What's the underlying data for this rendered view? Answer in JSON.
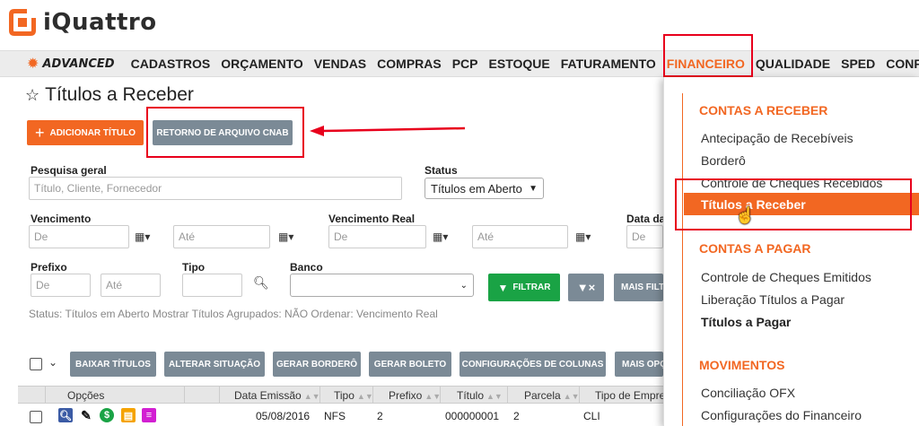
{
  "app": {
    "name": "iQuattro",
    "edition": "ADVANCED"
  },
  "nav": {
    "items": [
      "CADASTROS",
      "ORÇAMENTO",
      "VENDAS",
      "COMPRAS",
      "PCP",
      "ESTOQUE",
      "FATURAMENTO",
      "FINANCEIRO",
      "QUALIDADE",
      "SPED",
      "CONF"
    ],
    "active": "FINANCEIRO"
  },
  "page": {
    "title": "Títulos a Receber"
  },
  "actions": {
    "add_label": "ADICIONAR TÍTULO",
    "cnab_label": "RETORNO DE ARQUIVO CNAB"
  },
  "filters": {
    "search_label": "Pesquisa geral",
    "search_placeholder": "Título, Cliente, Fornecedor",
    "status_label": "Status",
    "status_value": "Títulos em Aberto",
    "vencimento_label": "Vencimento",
    "vencimento_real_label": "Vencimento Real",
    "data_label": "Data da",
    "de": "De",
    "ate": "Até",
    "prefixo_label": "Prefixo",
    "tipo_label": "Tipo",
    "banco_label": "Banco",
    "filtrar_label": "FILTRAR",
    "mais_filtros_label": "MAIS FILT"
  },
  "status_line": "Status: Títulos em Aberto   Mostrar Títulos Agrupados: NÃO   Ordenar: Vencimento Real",
  "toolbar": {
    "baixar": "BAIXAR TÍTULOS",
    "alterar": "ALTERAR SITUAÇÃO",
    "bordero": "GERAR BORDERÔ",
    "boleto": "GERAR BOLETO",
    "config": "CONFIGURAÇÕES DE COLUNAS",
    "mais": "MAIS OPÇ"
  },
  "table": {
    "headers": [
      "Opções",
      "Data Emissão",
      "Tipo",
      "Prefixo",
      "Título",
      "Parcela",
      "Tipo de Empre"
    ],
    "rows": [
      {
        "data_emissao": "05/08/2016",
        "tipo": "NFS",
        "prefixo": "2",
        "titulo": "000000001",
        "parcela": "2",
        "tipo_empresa": "CLI"
      }
    ]
  },
  "dropdown": {
    "contas_receber": "CONTAS A RECEBER",
    "antecipacao": "Antecipação de Recebíveis",
    "bordero": "Borderô",
    "controle_cheques_recebidos": "Controle de Cheques Recebidos",
    "titulos_receber": "Títulos a Receber",
    "contas_pagar": "CONTAS A PAGAR",
    "controle_cheques_emitidos": "Controle de Cheques Emitidos",
    "liberacao": "Liberação Títulos a Pagar",
    "titulos_pagar": "Títulos a Pagar",
    "movimentos": "MOVIMENTOS",
    "conciliacao": "Conciliação OFX",
    "configuracoes": "Configurações do Financeiro"
  },
  "colors": {
    "accent": "#f26722",
    "highlight": "#e8001c",
    "grey_button": "#7b8a96",
    "green_button": "#1aa345"
  }
}
